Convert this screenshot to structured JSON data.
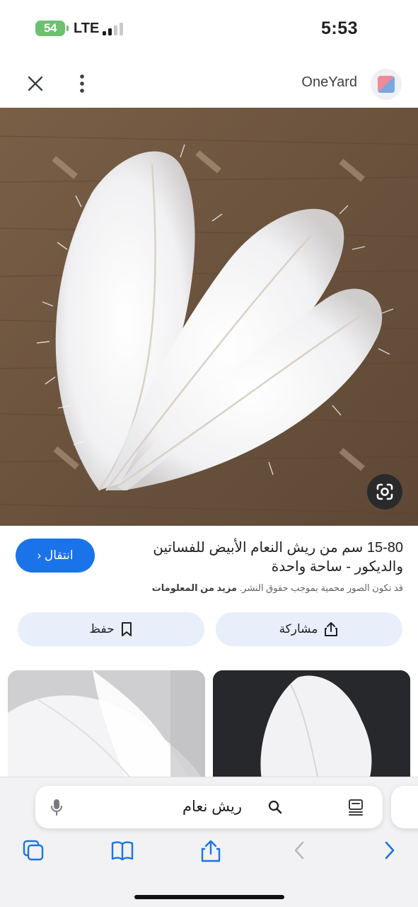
{
  "status_bar": {
    "battery": "54",
    "network": "LTE",
    "time": "5:53",
    "battery_color": "#6cc070"
  },
  "header": {
    "site_name": "OneYard",
    "close_icon": "close-icon",
    "more_icon": "more-vertical-icon"
  },
  "result": {
    "title": "15-80 سم من ريش النعام الأبيض للفساتين والديكور - ساحة واحدة",
    "open_label": "انتقال",
    "copyright_notice": "قد تكون الصور محمية بموجب حقوق النشر.",
    "more_info_link": "مزيد من المعلومات",
    "share_label": "مشاركة",
    "save_label": "حفظ",
    "accent_color": "#1a73e8"
  },
  "search": {
    "query": "ريش نعام"
  },
  "toolbar": {
    "icons": [
      "tabs-icon",
      "bookmarks-icon",
      "share-icon",
      "back-icon",
      "forward-icon"
    ]
  }
}
